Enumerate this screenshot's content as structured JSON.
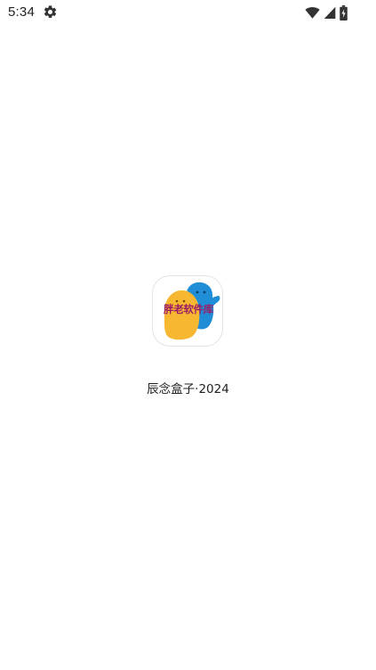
{
  "status_bar": {
    "time": "5:34",
    "icons": [
      "settings-icon",
      "wifi-icon",
      "cell-signal-icon",
      "battery-charging-icon"
    ]
  },
  "splash": {
    "icon_text": "胖老软件库",
    "app_name": "辰念盒子·2024"
  },
  "colors": {
    "background": "#ffffff",
    "text": "#222222",
    "icon_yellow": "#f7b731",
    "icon_blue": "#1f8ed6",
    "icon_text": "#9a1c66"
  }
}
